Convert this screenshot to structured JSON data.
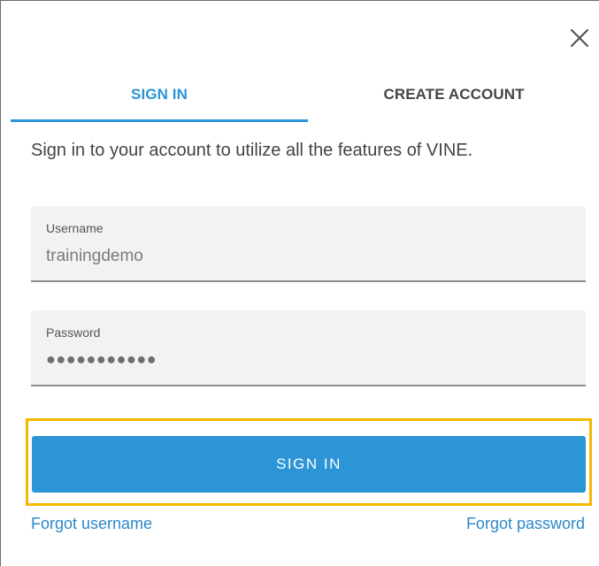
{
  "dialog": {
    "close_icon": "close-icon"
  },
  "tabs": [
    {
      "label": "SIGN IN",
      "active": true
    },
    {
      "label": "CREATE ACCOUNT",
      "active": false
    }
  ],
  "intro_text": "Sign in to your account to utilize all the features of VINE.",
  "form": {
    "username": {
      "label": "Username",
      "value": "trainingdemo"
    },
    "password": {
      "label": "Password",
      "masked_value": "●●●●●●●●●●●"
    }
  },
  "submit_label": "SIGN IN",
  "links": {
    "forgot_username": "Forgot username",
    "forgot_password": "Forgot password"
  },
  "colors": {
    "accent": "#2b95d6",
    "highlight": "#f5b800",
    "field_bg": "#f2f2f2"
  }
}
